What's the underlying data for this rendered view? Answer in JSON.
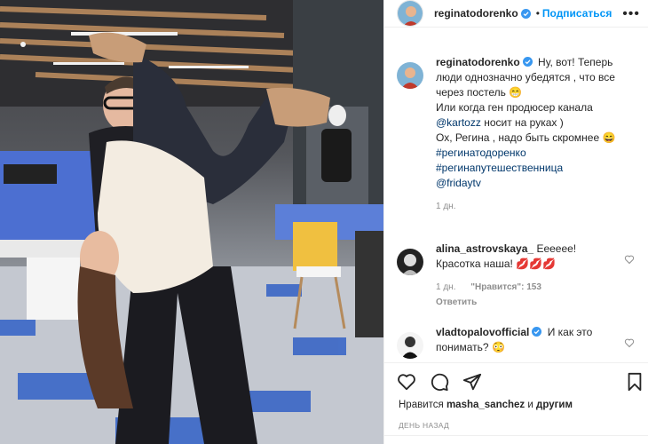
{
  "post": {
    "author": "reginatodorenko",
    "follow_label": "Подписаться",
    "caption": {
      "line1": "Ну, вот! Теперь",
      "line2": "люди однозначно убедятся , что все",
      "line3": "через постель",
      "emoji1": "😁",
      "line4": "Или когда ген продюсер канала",
      "mention": "@kartozz",
      "line5_tail": "носит на руках )",
      "line6": "Ох, Регина , надо быть скромнее",
      "emoji2": "😄",
      "tag1": "#регинатодоренко",
      "tag2": "#регинапутешественница",
      "tag3": "@fridaytv"
    },
    "caption_time": "1 дн."
  },
  "comments": [
    {
      "user": "alina_astrovskaya_",
      "text_line1": "Ееееее!",
      "text_line2": "Красотка наша!",
      "emoji": "💋💋💋",
      "time": "1 дн.",
      "likes_label": "\"Нравится\": 153",
      "reply_label": "Ответить"
    },
    {
      "user": "vladtopalovofficial",
      "text_line1": "И как это",
      "text_line2": "понимать?",
      "emoji": "😳"
    }
  ],
  "likes": {
    "prefix": "Нравится",
    "user": "masha_sanchez",
    "conj": "и",
    "suffix": "другим"
  },
  "date_label": "День назад",
  "icons": {
    "like": "heart-icon",
    "comment": "comment-bubble-icon",
    "share": "paper-plane-icon",
    "save": "bookmark-icon",
    "more": "more-dots-icon",
    "verified": "verified-badge-icon"
  },
  "colors": {
    "accent": "#0095f6",
    "verified": "#3897f0",
    "muted": "#8e8e8e",
    "link": "#00376b"
  }
}
